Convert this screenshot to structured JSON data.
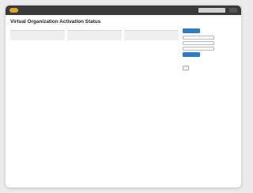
{
  "topbar": {
    "nav": [
      "",
      "",
      "",
      "",
      "",
      ""
    ],
    "active_index": 3
  },
  "page": {
    "title": "Virtual Organization Activation Status",
    "subtitle": ""
  },
  "columns": [
    {
      "header": "",
      "desc": "",
      "items": []
    },
    {
      "header": "",
      "desc": "",
      "items": []
    },
    {
      "header": "",
      "desc": "",
      "items": []
    }
  ],
  "sidebar": {
    "button1": "",
    "text1": "",
    "select1": "",
    "label1": "",
    "select2": "",
    "label2": "",
    "select3": "",
    "text2": "",
    "button2": "",
    "links": [],
    "order_button": "",
    "footer": ""
  },
  "colors": {
    "topbar": "#3a3a3a",
    "accent": "#e5a21b",
    "button": "#2d7cc4"
  }
}
